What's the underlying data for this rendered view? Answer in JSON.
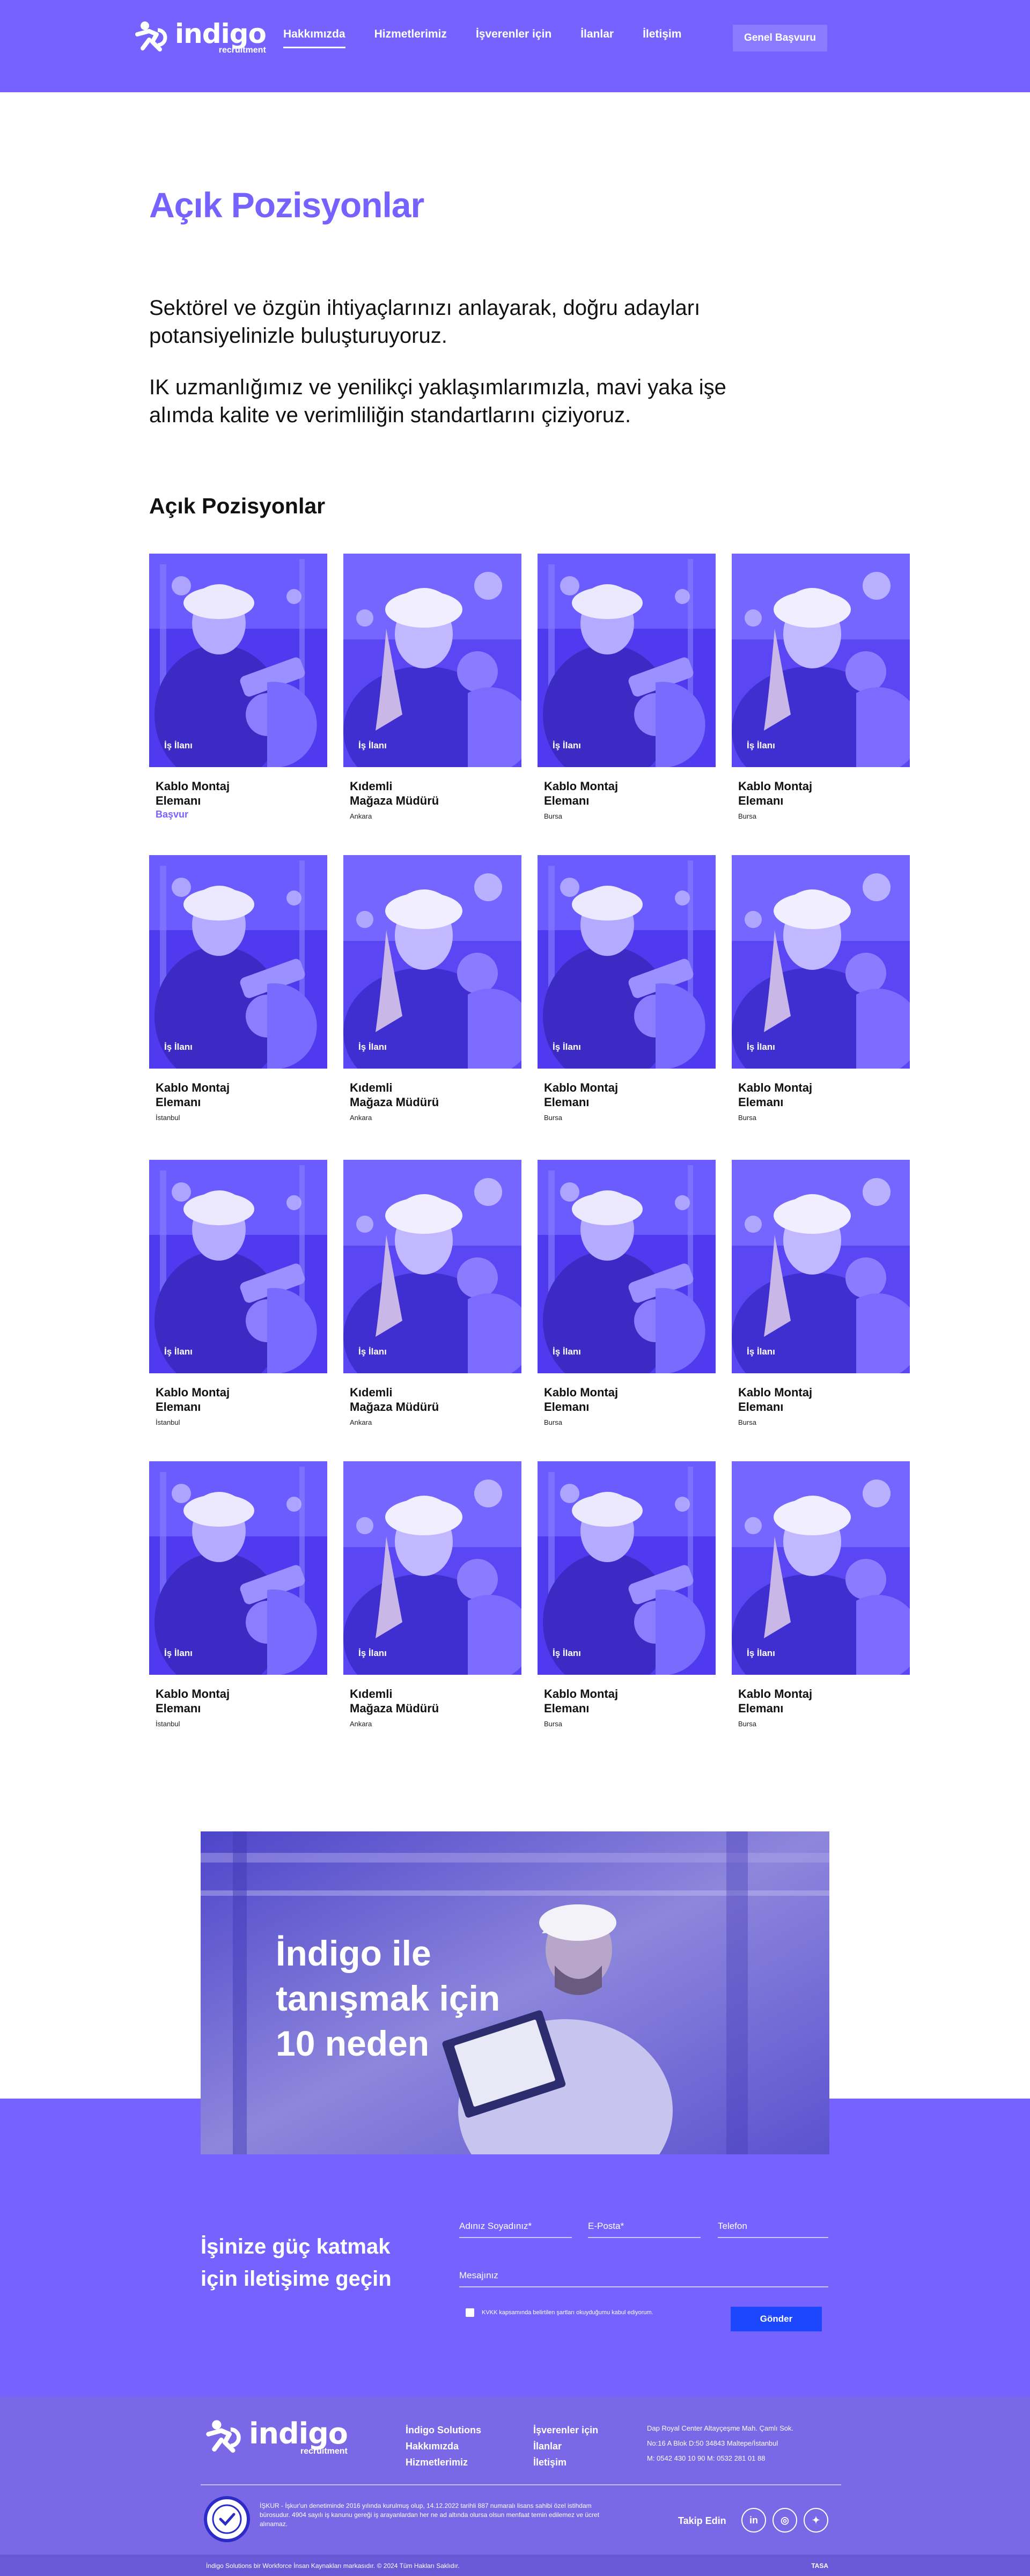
{
  "brand": {
    "name": "indigo",
    "sub": "recruitment"
  },
  "nav": {
    "items": [
      {
        "label": "Hakkımızda",
        "active": true
      },
      {
        "label": "Hizmetlerimiz",
        "active": false
      },
      {
        "label": "İşverenler için",
        "active": false
      },
      {
        "label": "İlanlar",
        "active": false
      },
      {
        "label": "İletişim",
        "active": false
      }
    ],
    "cta": "Genel Başvuru"
  },
  "hero": {
    "title": "Açık Pozisyonlar",
    "paragraphs": [
      "Sektörel ve özgün ihtiyaçlarınızı anlayarak, doğru adayları potansiyelinizle buluşturuyoruz.",
      "IK uzmanlığımız ve yenilikçi yaklaşımlarımızla, mavi yaka işe alımda kalite ve verimliliğin standartlarını çiziyoruz."
    ]
  },
  "jobs": {
    "section_title": "Açık Pozisyonlar",
    "tag": "İş İlanı",
    "apply_label": "Başvur",
    "rows": [
      [
        {
          "title": "Kablo Montaj\nElemanı",
          "city": "",
          "photo": "man",
          "show_apply": true
        },
        {
          "title": "Kıdemli\nMağaza Müdürü",
          "city": "Ankara",
          "photo": "woman"
        },
        {
          "title": "Kablo Montaj\nElemanı",
          "city": "Bursa",
          "photo": "man"
        },
        {
          "title": "Kablo Montaj\nElemanı",
          "city": "Bursa",
          "photo": "woman"
        }
      ],
      [
        {
          "title": "Kablo Montaj\nElemanı",
          "city": "İstanbul",
          "photo": "man"
        },
        {
          "title": "Kıdemli\nMağaza Müdürü",
          "city": "Ankara",
          "photo": "woman"
        },
        {
          "title": "Kablo Montaj\nElemanı",
          "city": "Bursa",
          "photo": "man"
        },
        {
          "title": "Kablo Montaj\nElemanı",
          "city": "Bursa",
          "photo": "woman"
        }
      ],
      [
        {
          "title": "Kablo Montaj\nElemanı",
          "city": "İstanbul",
          "photo": "man"
        },
        {
          "title": "Kıdemli\nMağaza Müdürü",
          "city": "Ankara",
          "photo": "woman"
        },
        {
          "title": "Kablo Montaj\nElemanı",
          "city": "Bursa",
          "photo": "man"
        },
        {
          "title": "Kablo Montaj\nElemanı",
          "city": "Bursa",
          "photo": "woman"
        }
      ],
      [
        {
          "title": "Kablo Montaj\nElemanı",
          "city": "İstanbul",
          "photo": "man"
        },
        {
          "title": "Kıdemli\nMağaza Müdürü",
          "city": "Ankara",
          "photo": "woman"
        },
        {
          "title": "Kablo Montaj\nElemanı",
          "city": "Bursa",
          "photo": "man"
        },
        {
          "title": "Kablo Montaj\nElemanı",
          "city": "Bursa",
          "photo": "woman"
        }
      ]
    ]
  },
  "promo": {
    "title_lines": [
      "İndigo ile",
      "tanışmak için",
      "10 neden"
    ]
  },
  "contact": {
    "title_lines": [
      "İşinize güç katmak",
      "için iletişime geçin"
    ],
    "fields": {
      "name_placeholder": "Adınız Soyadınız*",
      "email_placeholder": "E-Posta*",
      "phone_placeholder": "Telefon",
      "message_placeholder": "Mesajınız"
    },
    "kvkk": "KVKK kapsamında belirtilen şartları okuyduğumu kabul ediyorum.",
    "submit": "Gönder"
  },
  "footer": {
    "col1": [
      "İndigo Solutions",
      "Hakkımızda",
      "Hizmetlerimiz"
    ],
    "col2": [
      "İşverenler için",
      "İlanlar",
      "İletişim"
    ],
    "address_lines": [
      "Dap Royal Center Altayçeşme Mah. Çamlı Sok.",
      "No:16 A Blok D:50 34843        Maltepe/İstanbul",
      "M: 0542 430 10 90     M: 0532 281 01 88"
    ],
    "legal": "İŞKUR - İşkur'un denetiminde 2016 yılında kurulmuş olup, 14.12.2022 tarihli 887 numaralı lisans sahibi özel istihdam bürosudur. 4904 sayılı iş kanunu gereği iş arayanlardan her ne ad altında olursa olsun menfaat temin edilemez ve ücret alınamaz.",
    "follow": "Takip Edin",
    "social": [
      {
        "icon": "linkedin-icon",
        "glyph": "in"
      },
      {
        "icon": "instagram-icon",
        "glyph": "◎"
      },
      {
        "icon": "twitter-icon",
        "glyph": "✦"
      }
    ],
    "copyright": "İndigo Solutions bir Workforce İnsan Kaynakları markasıdır. © 2024 Tüm Hakları Saklıdır.",
    "credit": "TASA"
  },
  "colors": {
    "primary": "#7663ff",
    "submit": "#1d46ff",
    "footer": "#7a68e6"
  }
}
